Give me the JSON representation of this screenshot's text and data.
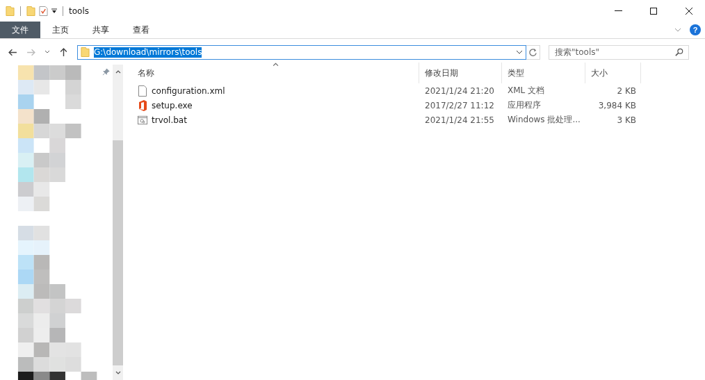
{
  "window": {
    "title": "tools"
  },
  "ribbon_tabs": [
    {
      "label": "文件",
      "selected": true
    },
    {
      "label": "主页",
      "selected": false
    },
    {
      "label": "共享",
      "selected": false
    },
    {
      "label": "查看",
      "selected": false
    }
  ],
  "help_button": {
    "label": "?"
  },
  "address_bar": {
    "value": "G:\\download\\mirrors\\tools"
  },
  "search": {
    "placeholder": "搜索\"tools\""
  },
  "columns": [
    {
      "label": "名称",
      "sorted": true
    },
    {
      "label": "修改日期",
      "sorted": false
    },
    {
      "label": "类型",
      "sorted": false
    },
    {
      "label": "大小",
      "sorted": false
    }
  ],
  "files": [
    {
      "kind": "xml",
      "name": "configuration.xml",
      "modified": "2021/1/24 21:20",
      "type": "XML 文档",
      "size": "2 KB"
    },
    {
      "kind": "exe",
      "name": "setup.exe",
      "modified": "2017/2/27 11:12",
      "type": "应用程序",
      "size": "3,984 KB"
    },
    {
      "kind": "bat",
      "name": "trvol.bat",
      "modified": "2021/1/24 21:55",
      "type": "Windows 批处理...",
      "size": "3 KB"
    }
  ]
}
